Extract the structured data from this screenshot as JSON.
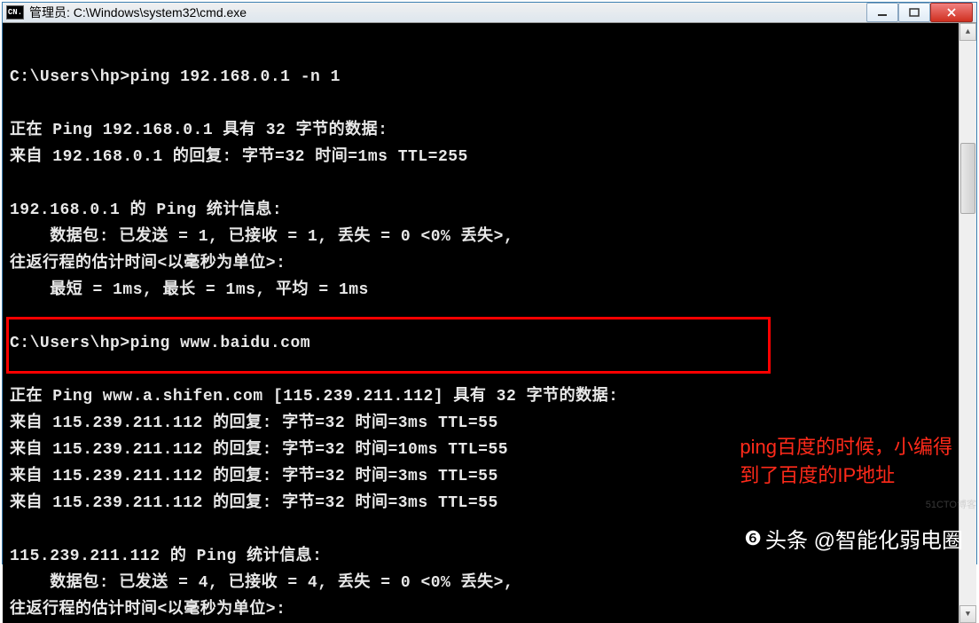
{
  "titlebar": {
    "icon_text": "CN.",
    "title": "管理员: C:\\Windows\\system32\\cmd.exe"
  },
  "terminal": {
    "lines": [
      "",
      "C:\\Users\\hp>ping 192.168.0.1 -n 1",
      "",
      "正在 Ping 192.168.0.1 具有 32 字节的数据:",
      "来自 192.168.0.1 的回复: 字节=32 时间=1ms TTL=255",
      "",
      "192.168.0.1 的 Ping 统计信息:",
      "    数据包: 已发送 = 1, 已接收 = 1, 丢失 = 0 <0% 丢失>,",
      "往返行程的估计时间<以毫秒为单位>:",
      "    最短 = 1ms, 最长 = 1ms, 平均 = 1ms",
      "",
      "C:\\Users\\hp>ping www.baidu.com",
      "",
      "正在 Ping www.a.shifen.com [115.239.211.112] 具有 32 字节的数据:",
      "来自 115.239.211.112 的回复: 字节=32 时间=3ms TTL=55",
      "来自 115.239.211.112 的回复: 字节=32 时间=10ms TTL=55",
      "来自 115.239.211.112 的回复: 字节=32 时间=3ms TTL=55",
      "来自 115.239.211.112 的回复: 字节=32 时间=3ms TTL=55",
      "",
      "115.239.211.112 的 Ping 统计信息:",
      "    数据包: 已发送 = 4, 已接收 = 4, 丢失 = 0 <0% 丢失>,",
      "往返行程的估计时间<以毫秒为单位>:"
    ]
  },
  "annotation": {
    "line1": "ping百度的时候，小编得",
    "line2": "到了百度的IP地址"
  },
  "watermark": {
    "bottom": "头条 @智能化弱电圈",
    "side": "51CTO博客"
  }
}
